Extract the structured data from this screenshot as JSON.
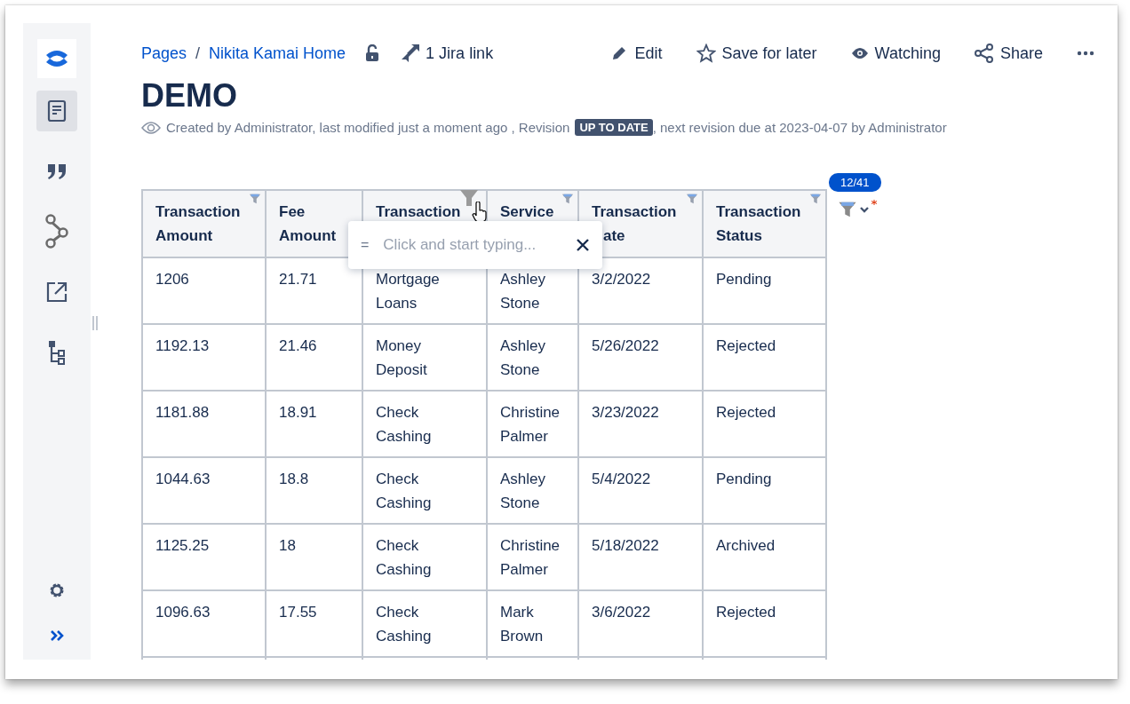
{
  "sidebar": {
    "items": [
      {
        "kind": "page",
        "selected": true
      },
      {
        "kind": "quote",
        "selected": false
      },
      {
        "kind": "nodes",
        "selected": false
      },
      {
        "kind": "external",
        "selected": false
      },
      {
        "kind": "tree",
        "selected": false
      }
    ],
    "bottom": [
      {
        "kind": "settings"
      },
      {
        "kind": "expand"
      }
    ]
  },
  "breadcrumbs": [
    "Pages",
    "Nikita Kamai Home"
  ],
  "separator": "/",
  "jira_link": "1 Jira link",
  "actions": [
    {
      "kind": "edit",
      "label": "Edit"
    },
    {
      "kind": "save",
      "label": "Save for later"
    },
    {
      "kind": "watch",
      "label": "Watching"
    },
    {
      "kind": "share",
      "label": "Share"
    },
    {
      "kind": "more"
    }
  ],
  "title": "DEMO",
  "meta": {
    "before": "Created by Administrator, last modified just a moment ago , Revision",
    "badge": "UP TO DATE",
    "after": ", next revision due at 2023-04-07 by Administrator"
  },
  "filter_counter": "12/41",
  "filter_popup": {
    "operator": "=",
    "placeholder": "Click and start typing..."
  },
  "table": {
    "columns": [
      {
        "lines": [
          {
            "text": "Transaction"
          },
          {
            "text": "Amount"
          }
        ],
        "filterable": true,
        "hovered": false
      },
      {
        "lines": [
          {
            "text": "Fee"
          },
          {
            "text": "Amount"
          }
        ],
        "filterable": false
      },
      {
        "lines": [
          {
            "text": "Transaction"
          }
        ],
        "filterable": true,
        "hovered": true
      },
      {
        "lines": [
          {
            "text": "Service"
          }
        ],
        "filterable": true,
        "hovered": false
      },
      {
        "lines": [
          {
            "text": "Transaction"
          },
          {
            "text": "ate",
            "covered": true
          }
        ],
        "filterable": true,
        "hovered": false
      },
      {
        "lines": [
          {
            "text": "Transaction"
          },
          {
            "text": "Status"
          }
        ],
        "filterable": true,
        "hovered": false
      }
    ],
    "rows": [
      [
        "1206",
        "21.71",
        "Mortgage Loans",
        "Ashley Stone",
        "3/2/2022",
        "Pending"
      ],
      [
        "1192.13",
        "21.46",
        "Money Deposit",
        "Ashley Stone",
        "5/26/2022",
        "Rejected"
      ],
      [
        "1181.88",
        "18.91",
        "Check Cashing",
        "Christine Palmer",
        "3/23/2022",
        "Rejected"
      ],
      [
        "1044.63",
        "18.8",
        "Check Cashing",
        "Ashley Stone",
        "5/4/2022",
        "Pending"
      ],
      [
        "1125.25",
        "18",
        "Check Cashing",
        "Christine Palmer",
        "5/18/2022",
        "Archived"
      ],
      [
        "1096.63",
        "17.55",
        "Check Cashing",
        "Mark Brown",
        "3/6/2022",
        "Rejected"
      ]
    ]
  }
}
